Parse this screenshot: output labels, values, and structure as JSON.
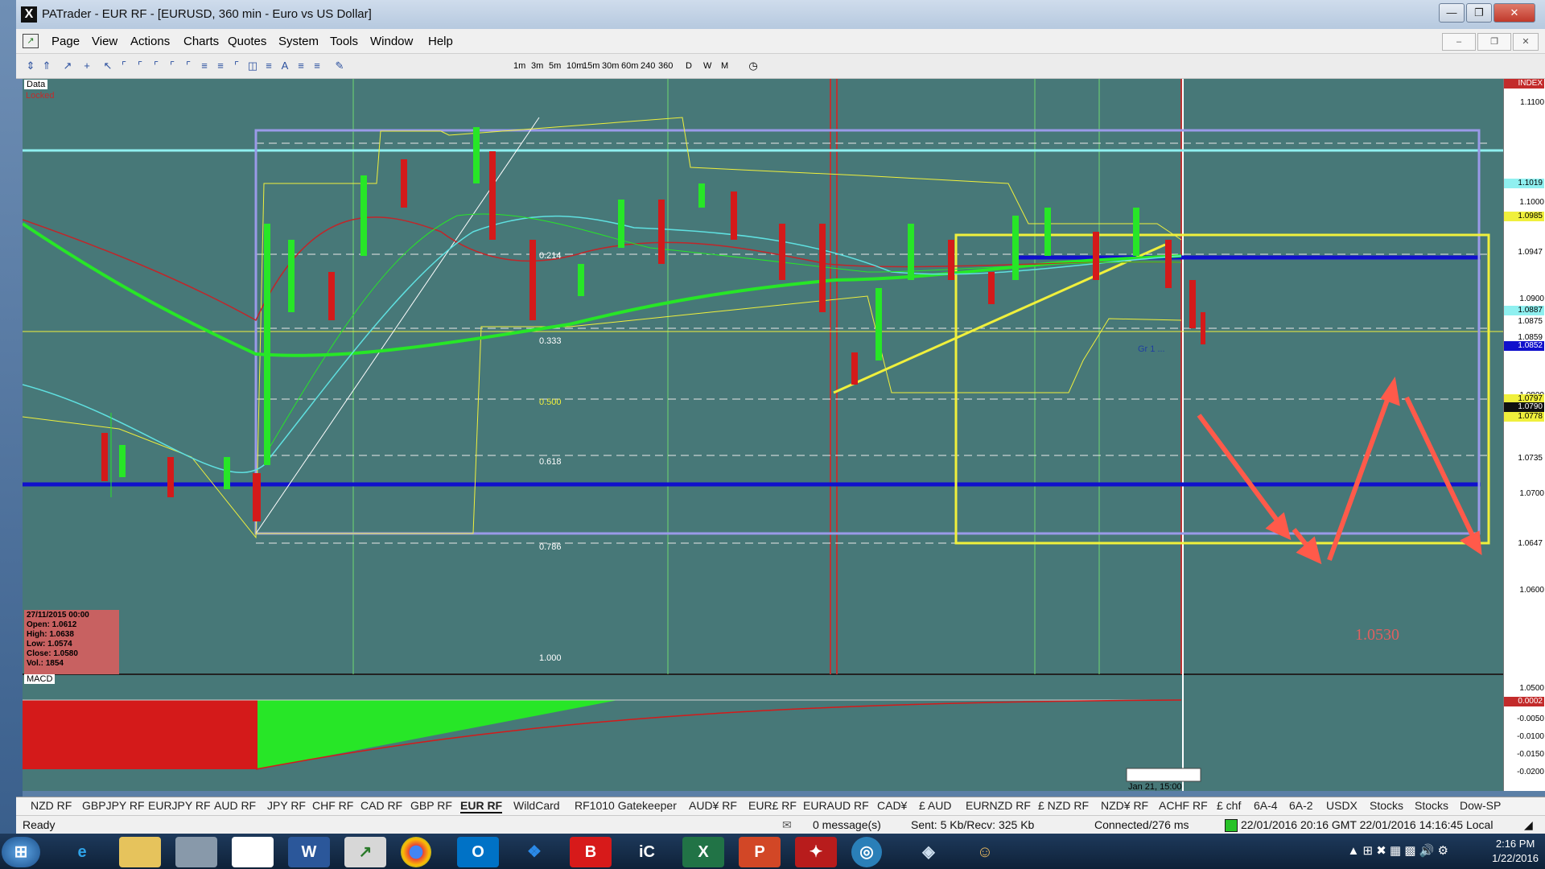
{
  "window": {
    "title": "PATrader - EUR RF - [EURUSD, 360 min - Euro vs US Dollar]"
  },
  "menu": [
    "Page",
    "View",
    "Actions",
    "Charts",
    "Quotes",
    "System",
    "Tools",
    "Window",
    "Help"
  ],
  "timeframes": [
    "1m",
    "3m",
    "5m",
    "10m",
    "15m",
    "30m",
    "60m",
    "240",
    "360",
    "D",
    "W",
    "M"
  ],
  "chart": {
    "data_label": "Data",
    "locked_label": "Locked",
    "indicator_label": "MACD",
    "index_label": "INDEX",
    "fib_labels": [
      "0.214",
      "0.333",
      "0.500",
      "0.618",
      "0.786",
      "1.000"
    ],
    "target_label": "1.0530",
    "annotation": "Gr 1 ...",
    "cursor_time": "Jan 21, 15:00",
    "info": {
      "date": "27/11/2015 00:00",
      "open": "Open: 1.0612",
      "high": "High: 1.0638",
      "low": "Low: 1.0574",
      "close": "Close: 1.0580",
      "vol": "Vol.: 1854"
    },
    "colors": {
      "background": "#477878",
      "bull": "#27e627",
      "bear": "#d41a1a",
      "fib_box": "#9a9ae8",
      "yellow": "#f0f03c",
      "blue_line": "#1010cc",
      "cyan_line": "#8ff0f0",
      "arrows": "#ff5a4a"
    }
  },
  "y_axis": {
    "ticks": [
      "1.1100",
      "1.1000",
      "1.0900",
      "1.0800",
      "1.0700",
      "1.0600",
      "1.0500"
    ],
    "badges": [
      {
        "label": "1.1019",
        "color": "#8ff0f0"
      },
      {
        "label": "1.0985",
        "color": "#f0f03c"
      },
      {
        "label": "1.0947",
        "color": "#ffffff"
      },
      {
        "label": "1.0887",
        "color": "#8ff0f0"
      },
      {
        "label": "1.0875",
        "color": "#ffffff"
      },
      {
        "label": "1.0859",
        "color": "#ffffff"
      },
      {
        "label": "1.0852",
        "color": "#1010cc"
      },
      {
        "label": "1.0797",
        "color": "#f0f03c"
      },
      {
        "label": "1.0790",
        "color": "#111111"
      },
      {
        "label": "1.0778",
        "color": "#f0f03c"
      },
      {
        "label": "1.0735",
        "color": "#ffffff"
      },
      {
        "label": "1.0647",
        "color": "#ffffff"
      }
    ],
    "macd_ticks": [
      "0.0002",
      "-0.0050",
      "-0.0100",
      "-0.0150",
      "-0.0200"
    ]
  },
  "tabs": [
    "NZD RF",
    "GBPJPY RF",
    "EURJPY RF",
    "AUD RF",
    "JPY RF",
    "CHF RF",
    "CAD RF",
    "GBP RF",
    "EUR RF",
    "WildCard",
    "RF1010 Gatekeeper",
    "AUD¥ RF",
    "EUR£ RF",
    "EURAUD RF",
    "CAD¥",
    "£ AUD",
    "EURNZD RF",
    "£ NZD RF",
    "NZD¥ RF",
    "ACHF RF",
    "£ chf",
    "6A-4",
    "6A-2",
    "USDX",
    "Stocks",
    "Stocks",
    "Dow-SP"
  ],
  "active_tab": "EUR RF",
  "status": {
    "ready": "Ready",
    "messages": "0 message(s)",
    "traffic": "Sent: 5 Kb/Recv: 325 Kb",
    "connection": "Connected/276 ms",
    "time": "22/01/2016 20:16 GMT  22/01/2016 14:16:45 Local"
  },
  "taskbar": {
    "time": "2:16 PM",
    "date": "1/22/2016"
  }
}
